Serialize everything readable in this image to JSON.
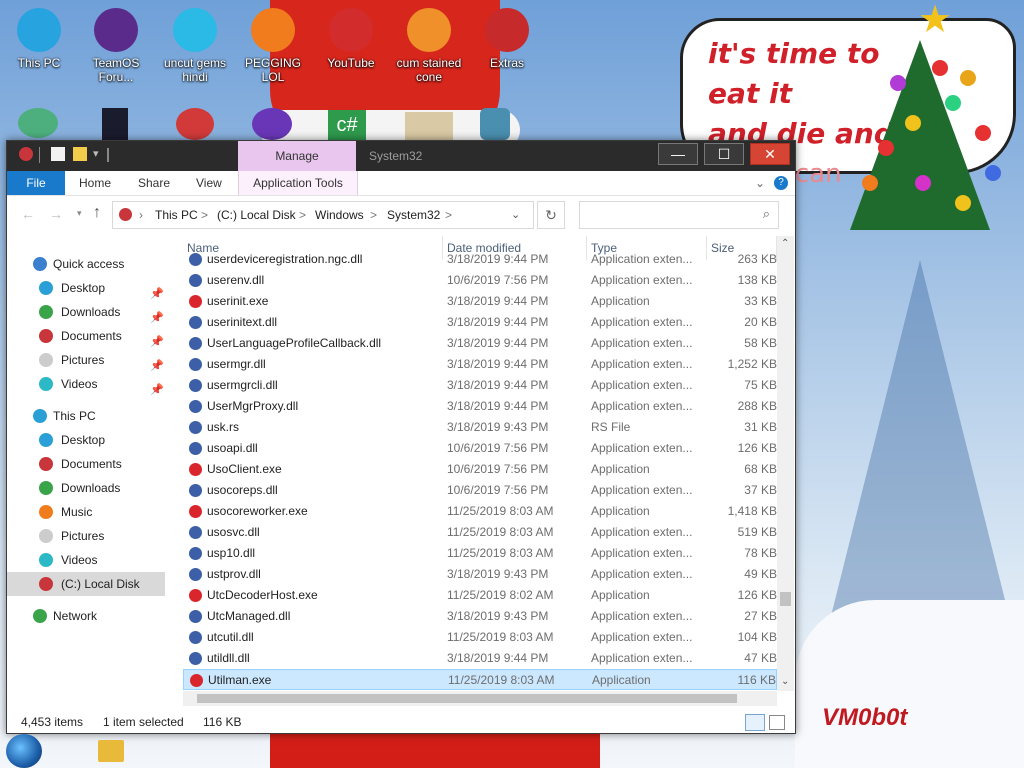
{
  "desktop": {
    "icons": [
      {
        "label": "This PC",
        "icon": "monitor-icon",
        "color": "#27a3e0"
      },
      {
        "label": "TeamOS Foru...",
        "icon": "orb-icon",
        "color": "#5a2b8a"
      },
      {
        "label": "uncut gems hindi",
        "icon": "diamond-icon",
        "color": "#2bb9e6"
      },
      {
        "label": "PEGGING LOL",
        "icon": "letter-p-icon",
        "color": "#f07c1d"
      },
      {
        "label": "YouTube",
        "icon": "angry-bird-icon",
        "color": "#d22c2c"
      },
      {
        "label": "cum stained cone",
        "icon": "traffic-cone-icon",
        "color": "#f0902a"
      },
      {
        "label": "Extras",
        "icon": "book-icon",
        "color": "#c62a2a"
      }
    ],
    "bubble_line1": "it's time to eat it",
    "bubble_line2": "and die and c",
    "bubble_line3": "candy can",
    "signature": "VM0b0t"
  },
  "window": {
    "title": "System32",
    "manage_label": "Manage",
    "minimize": "—",
    "maximize": "☐",
    "close": "✕",
    "ribbon": {
      "file": "File",
      "home": "Home",
      "share": "Share",
      "view": "View",
      "app_tools": "Application Tools",
      "expand": "⌄",
      "help": "?"
    },
    "address": {
      "crumbs": [
        "This PC",
        "(C:) Local Disk",
        "Windows",
        "System32"
      ],
      "sep": ">"
    },
    "search_placeholder": "",
    "nav": {
      "quick_access": "Quick access",
      "quick_items": [
        "Desktop",
        "Downloads",
        "Documents",
        "Pictures",
        "Videos"
      ],
      "this_pc": "This PC",
      "pc_items": [
        "Desktop",
        "Documents",
        "Downloads",
        "Music",
        "Pictures",
        "Videos",
        "(C:) Local Disk"
      ],
      "network": "Network"
    },
    "columns": {
      "name": "Name",
      "date": "Date modified",
      "type": "Type",
      "size": "Size"
    },
    "files": [
      {
        "name": "userdeviceregistration.ngc.dll",
        "date": "3/18/2019 9:44 PM",
        "type": "Application exten...",
        "size": "263 KB",
        "exe": false
      },
      {
        "name": "userenv.dll",
        "date": "10/6/2019 7:56 PM",
        "type": "Application exten...",
        "size": "138 KB",
        "exe": false
      },
      {
        "name": "userinit.exe",
        "date": "3/18/2019 9:44 PM",
        "type": "Application",
        "size": "33 KB",
        "exe": true
      },
      {
        "name": "userinitext.dll",
        "date": "3/18/2019 9:44 PM",
        "type": "Application exten...",
        "size": "20 KB",
        "exe": false
      },
      {
        "name": "UserLanguageProfileCallback.dll",
        "date": "3/18/2019 9:44 PM",
        "type": "Application exten...",
        "size": "58 KB",
        "exe": false
      },
      {
        "name": "usermgr.dll",
        "date": "3/18/2019 9:44 PM",
        "type": "Application exten...",
        "size": "1,252 KB",
        "exe": false
      },
      {
        "name": "usermgrcli.dll",
        "date": "3/18/2019 9:44 PM",
        "type": "Application exten...",
        "size": "75 KB",
        "exe": false
      },
      {
        "name": "UserMgrProxy.dll",
        "date": "3/18/2019 9:44 PM",
        "type": "Application exten...",
        "size": "288 KB",
        "exe": false
      },
      {
        "name": "usk.rs",
        "date": "3/18/2019 9:43 PM",
        "type": "RS File",
        "size": "31 KB",
        "exe": false
      },
      {
        "name": "usoapi.dll",
        "date": "10/6/2019 7:56 PM",
        "type": "Application exten...",
        "size": "126 KB",
        "exe": false
      },
      {
        "name": "UsoClient.exe",
        "date": "10/6/2019 7:56 PM",
        "type": "Application",
        "size": "68 KB",
        "exe": true
      },
      {
        "name": "usocoreps.dll",
        "date": "10/6/2019 7:56 PM",
        "type": "Application exten...",
        "size": "37 KB",
        "exe": false
      },
      {
        "name": "usocoreworker.exe",
        "date": "11/25/2019 8:03 AM",
        "type": "Application",
        "size": "1,418 KB",
        "exe": true
      },
      {
        "name": "usosvc.dll",
        "date": "11/25/2019 8:03 AM",
        "type": "Application exten...",
        "size": "519 KB",
        "exe": false
      },
      {
        "name": "usp10.dll",
        "date": "11/25/2019 8:03 AM",
        "type": "Application exten...",
        "size": "78 KB",
        "exe": false
      },
      {
        "name": "ustprov.dll",
        "date": "3/18/2019 9:43 PM",
        "type": "Application exten...",
        "size": "49 KB",
        "exe": false
      },
      {
        "name": "UtcDecoderHost.exe",
        "date": "11/25/2019 8:02 AM",
        "type": "Application",
        "size": "126 KB",
        "exe": true
      },
      {
        "name": "UtcManaged.dll",
        "date": "3/18/2019 9:43 PM",
        "type": "Application exten...",
        "size": "27 KB",
        "exe": false
      },
      {
        "name": "utcutil.dll",
        "date": "11/25/2019 8:03 AM",
        "type": "Application exten...",
        "size": "104 KB",
        "exe": false
      },
      {
        "name": "utildll.dll",
        "date": "3/18/2019 9:44 PM",
        "type": "Application exten...",
        "size": "47 KB",
        "exe": false
      },
      {
        "name": "Utilman.exe",
        "date": "11/25/2019 8:03 AM",
        "type": "Application",
        "size": "116 KB",
        "exe": true,
        "selected": true
      }
    ],
    "status": {
      "items": "4,453 items",
      "selected": "1 item selected",
      "size": "116 KB"
    }
  },
  "colors": {
    "accent": "#1979ca",
    "selection": "#cce8ff",
    "exe_icon": "#d9262d",
    "dll_icon": "#3c5fa8"
  }
}
